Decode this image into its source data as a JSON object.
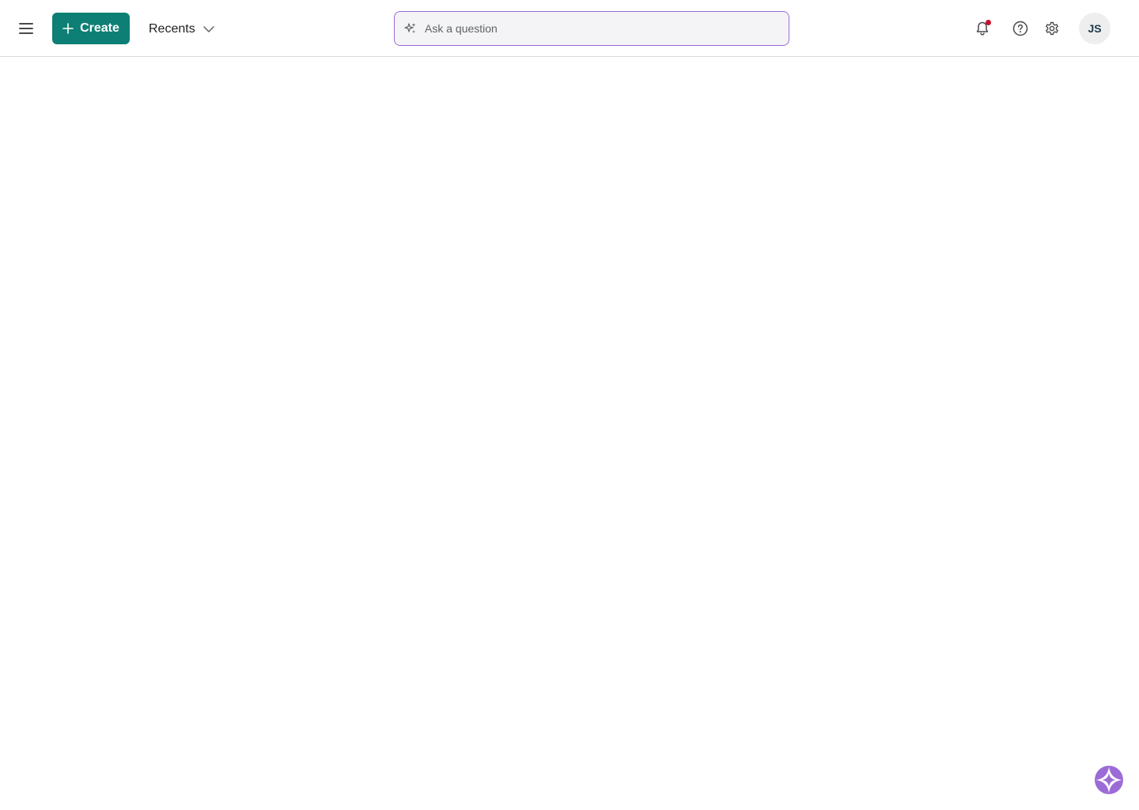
{
  "header": {
    "create_label": "Create",
    "recents_label": "Recents",
    "ask": {
      "placeholder": "Ask a question",
      "value": ""
    },
    "user_initials": "JS"
  },
  "icons": {
    "menu": "hamburger-menu-icon",
    "create": "plus-icon",
    "recents": "chevron-down-icon",
    "ask": "sparkle-icon",
    "notifications": "bell-icon",
    "help": "help-circle-icon",
    "settings": "gear-icon",
    "assistant": "assistant-sparkle-icon"
  },
  "colors": {
    "brand": "#0e7f74",
    "ask_border": "#9b6bd6",
    "notification_dot": "#c8102e",
    "assistant": "#9b6bd6"
  }
}
